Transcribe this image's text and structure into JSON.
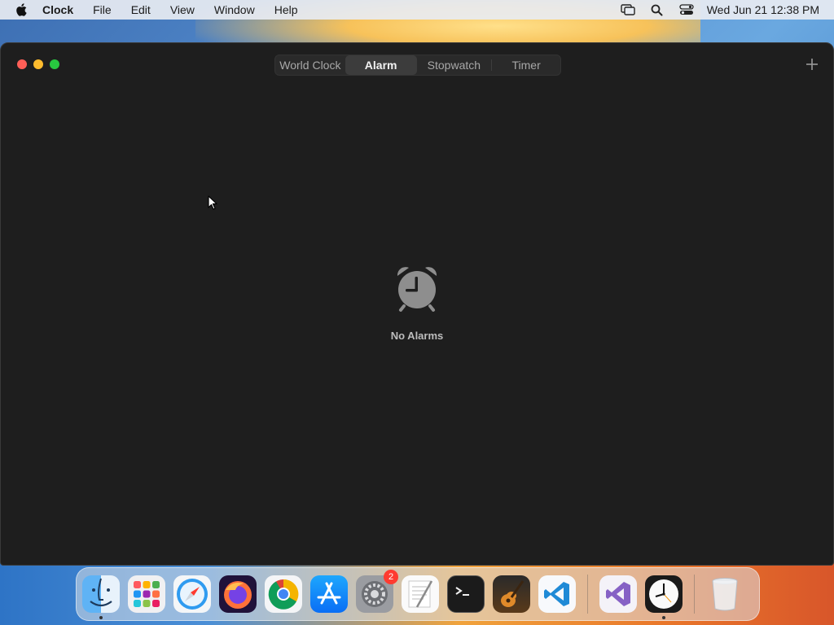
{
  "menubar": {
    "app_name": "Clock",
    "items": [
      "File",
      "Edit",
      "View",
      "Window",
      "Help"
    ],
    "datetime": "Wed Jun 21  12:38 PM"
  },
  "window": {
    "tabs": [
      "World Clock",
      "Alarm",
      "Stopwatch",
      "Timer"
    ],
    "active_tab": "Alarm",
    "add_button_label": "+",
    "empty_state": {
      "icon": "alarm-clock-icon",
      "text": "No Alarms"
    }
  },
  "dock": {
    "apps": [
      {
        "name": "Finder",
        "icon": "finder-icon",
        "running": true
      },
      {
        "name": "Launchpad",
        "icon": "launchpad-icon"
      },
      {
        "name": "Safari",
        "icon": "safari-icon"
      },
      {
        "name": "Firefox",
        "icon": "firefox-icon"
      },
      {
        "name": "Chrome",
        "icon": "chrome-icon"
      },
      {
        "name": "App Store",
        "icon": "app-store-icon"
      },
      {
        "name": "System Settings",
        "icon": "system-settings-icon",
        "badge": "2"
      },
      {
        "name": "TextEdit",
        "icon": "textedit-icon"
      },
      {
        "name": "Terminal",
        "icon": "terminal-icon"
      },
      {
        "name": "GarageBand",
        "icon": "garageband-icon"
      },
      {
        "name": "Visual Studio Code",
        "icon": "vscode-icon"
      },
      {
        "name": "Visual Studio",
        "icon": "visual-studio-icon"
      },
      {
        "name": "Clock",
        "icon": "clock-icon",
        "running": true
      },
      {
        "name": "Trash",
        "icon": "trash-icon"
      }
    ]
  },
  "colors": {
    "window_bg": "#1e1e1e",
    "close": "#ff5f57",
    "minimize": "#febc2e",
    "maximize": "#28c840",
    "badge": "#ff3b30"
  }
}
